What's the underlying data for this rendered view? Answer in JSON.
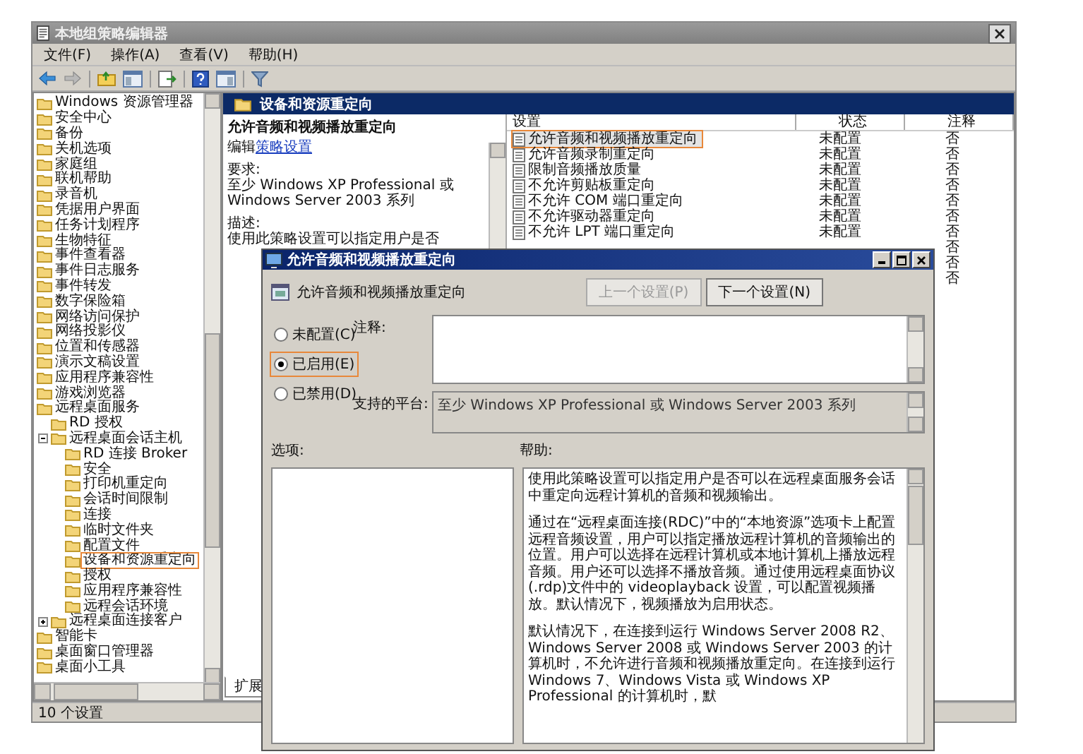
{
  "window": {
    "title": "本地组策略编辑器"
  },
  "menu": [
    "文件(F)",
    "操作(A)",
    "查看(V)",
    "帮助(H)"
  ],
  "tree": {
    "items": [
      {
        "label": "Windows 资源管理器",
        "selected": false
      },
      {
        "label": "安全中心",
        "selected": false
      },
      {
        "label": "备份",
        "selected": false
      },
      {
        "label": "关机选项",
        "selected": false
      },
      {
        "label": "家庭组",
        "selected": false
      },
      {
        "label": "联机帮助",
        "selected": false
      },
      {
        "label": "录音机",
        "selected": false
      },
      {
        "label": "凭据用户界面",
        "selected": false
      },
      {
        "label": "任务计划程序",
        "selected": false
      },
      {
        "label": "生物特征",
        "selected": false
      },
      {
        "label": "事件查看器",
        "selected": false
      },
      {
        "label": "事件日志服务",
        "selected": false
      },
      {
        "label": "事件转发",
        "selected": false
      },
      {
        "label": "数字保险箱",
        "selected": false
      },
      {
        "label": "网络访问保护",
        "selected": false
      },
      {
        "label": "网络投影仪",
        "selected": false
      },
      {
        "label": "位置和传感器",
        "selected": false
      },
      {
        "label": "演示文稿设置",
        "selected": false
      },
      {
        "label": "应用程序兼容性",
        "selected": false
      },
      {
        "label": "游戏浏览器",
        "selected": false
      },
      {
        "label": "远程桌面服务",
        "selected": false,
        "children": [
          {
            "label": "RD 授权",
            "selected": false
          },
          {
            "label": "远程桌面会话主机",
            "selected": false,
            "expanded": true,
            "children": [
              {
                "label": "RD 连接 Broker",
                "selected": false
              },
              {
                "label": "安全",
                "selected": false
              },
              {
                "label": "打印机重定向",
                "selected": false
              },
              {
                "label": "会话时间限制",
                "selected": false
              },
              {
                "label": "连接",
                "selected": false
              },
              {
                "label": "临时文件夹",
                "selected": false
              },
              {
                "label": "配置文件",
                "selected": false
              },
              {
                "label": "设备和资源重定向",
                "selected": true
              },
              {
                "label": "授权",
                "selected": false
              },
              {
                "label": "应用程序兼容性",
                "selected": false
              },
              {
                "label": "远程会话环境",
                "selected": false
              }
            ]
          },
          {
            "label": "远程桌面连接客户",
            "selected": false,
            "expanded": false
          }
        ]
      },
      {
        "label": "智能卡",
        "selected": false
      },
      {
        "label": "桌面窗口管理器",
        "selected": false
      },
      {
        "label": "桌面小工具",
        "selected": false
      }
    ]
  },
  "pane": {
    "header": "设备和资源重定向",
    "description": {
      "title": "允许音频和视频播放重定向",
      "edit_prefix": "编辑",
      "edit_link": "策略设置",
      "requirement_label": "要求:",
      "requirement": "至少 Windows XP Professional 或 Windows Server 2003 系列",
      "description_label": "描述:",
      "description_start": "使用此策略设置可以指定用户是否"
    },
    "tabs": [
      {
        "label": "扩展",
        "selected": true
      }
    ]
  },
  "table": {
    "columns": [
      "设置",
      "状态",
      "注释"
    ],
    "rows": [
      {
        "name": "允许音频和视频播放重定向",
        "status": "未配置",
        "note": "否",
        "selected": true
      },
      {
        "name": "允许音频录制重定向",
        "status": "未配置",
        "note": "否",
        "selected": false
      },
      {
        "name": "限制音频播放质量",
        "status": "未配置",
        "note": "否",
        "selected": false
      },
      {
        "name": "不允许剪贴板重定向",
        "status": "未配置",
        "note": "否",
        "selected": false
      },
      {
        "name": "不允许 COM 端口重定向",
        "status": "未配置",
        "note": "否",
        "selected": false
      },
      {
        "name": "不允许驱动器重定向",
        "status": "未配置",
        "note": "否",
        "selected": false
      },
      {
        "name": "不允许 LPT 端口重定向",
        "status": "未配置",
        "note": "否",
        "selected": false
      },
      {
        "note": "否"
      },
      {
        "note": "否"
      },
      {
        "note": "否"
      }
    ]
  },
  "status_bar": "10 个设置",
  "dialog": {
    "title": "允许音频和视频播放重定向",
    "setting_name": "允许音频和视频播放重定向",
    "buttons": [
      {
        "label": "上一个设置(P)",
        "disabled": true
      },
      {
        "label": "下一个设置(N)",
        "disabled": false
      }
    ],
    "options": [
      {
        "label": "未配置(C)",
        "selected": false
      },
      {
        "label": "已启用(E)",
        "selected": true
      },
      {
        "label": "已禁用(D)",
        "selected": false
      }
    ],
    "comment_label": "注释:",
    "platform_label": "支持的平台:",
    "platform": "至少 Windows XP Professional 或 Windows Server 2003 系列",
    "options_label": "选项:",
    "help_label": "帮助:",
    "help": [
      "使用此策略设置可以指定用户是否可以在远程桌面服务会话中重定向远程计算机的音频和视频输出。",
      "通过在“远程桌面连接(RDC)”中的“本地资源”选项卡上配置远程音频设置，用户可以指定播放远程计算机的音频输出的位置。用户可以选择在远程计算机或本地计算机上播放远程音频。用户还可以选择不播放音频。通过使用远程桌面协议(.rdp)文件中的 videoplayback 设置，可以配置视频播放。默认情况下，视频播放为启用状态。",
      "默认情况下，在连接到运行 Windows Server 2008 R2、Windows Server 2008 或 Windows Server 2003 的计算机时，不允许进行音频和视频播放重定向。在连接到运行 Windows 7、Windows Vista 或 Windows XP Professional 的计算机时，默"
    ]
  }
}
